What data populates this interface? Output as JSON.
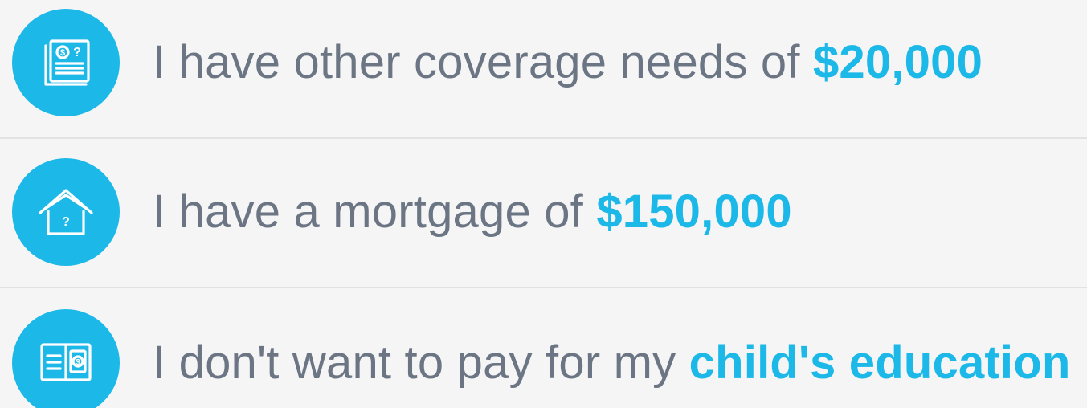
{
  "items": [
    {
      "icon": "receipt-dollar-question-icon",
      "prefix": "I have other coverage needs of ",
      "highlight": "$20,000"
    },
    {
      "icon": "house-question-icon",
      "prefix": "I have a mortgage of ",
      "highlight": "$150,000"
    },
    {
      "icon": "book-dollar-icon",
      "prefix": "I don't want to pay for my ",
      "highlight": "child's education"
    }
  ],
  "colors": {
    "accent": "#1bb8e8",
    "text": "#6b7583",
    "background": "#f5f5f6",
    "divider": "#e2e2e4"
  }
}
